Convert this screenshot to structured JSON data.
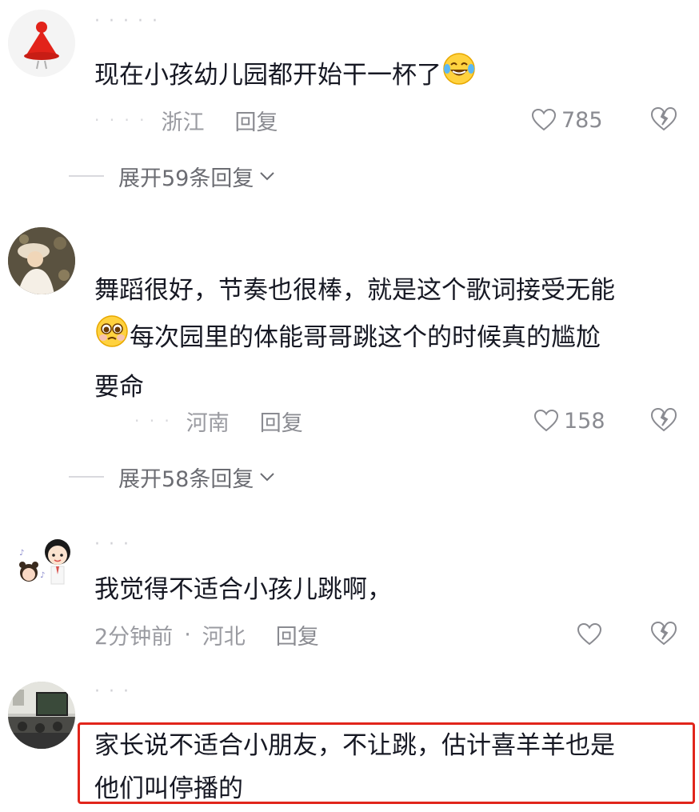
{
  "comments": [
    {
      "username": "· · · · ·",
      "text": "现在小孩幼儿园都开始干一杯了",
      "emoji": "crying-laughing-emoji",
      "meta_blur": "· · · ·",
      "location": "浙江",
      "reply_label": "回复",
      "like_count": "785",
      "expand_label": "展开59条回复"
    },
    {
      "username": "",
      "text_line1": "舞蹈很好，节奏也很棒，就是这个歌词接受无能",
      "text_line2": "每次园里的体能哥哥跳这个的时候真的尴尬",
      "text_line3": "要命",
      "emoji": "pleading-emoji",
      "meta_blur": "· · ·",
      "location": "河南",
      "reply_label": "回复",
      "like_count": "158",
      "expand_label": "展开58条回复"
    },
    {
      "username": "· · ·",
      "text": "我觉得不适合小孩儿跳啊，",
      "time": "2分钟前",
      "separator": "·",
      "location": "河北",
      "reply_label": "回复",
      "like_count": ""
    },
    {
      "username": "· · ·",
      "text_line1": "家长说不适合小朋友，不让跳，估计喜羊羊也是",
      "text_line2": "他们叫停播的"
    }
  ],
  "colors": {
    "highlight": "#e1251b",
    "meta": "#9a9ba1",
    "text": "#161823"
  }
}
